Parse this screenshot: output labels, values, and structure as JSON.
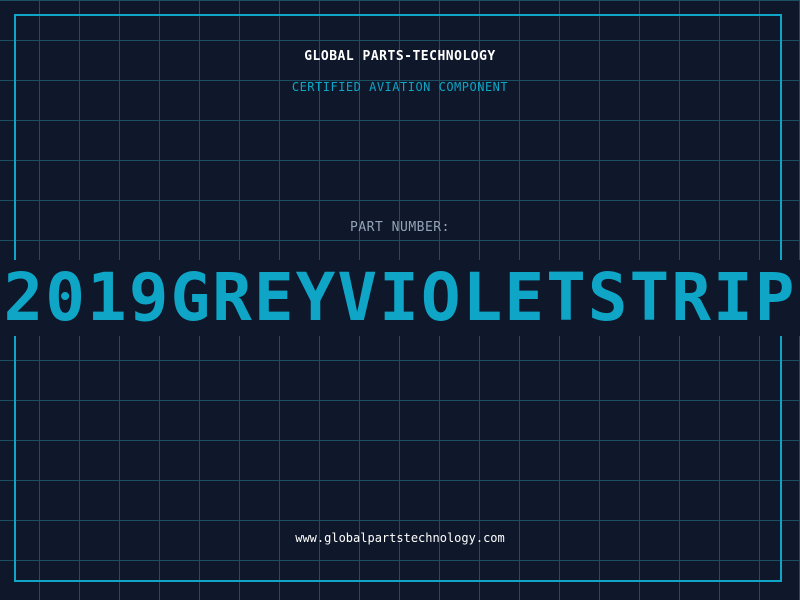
{
  "label": {
    "company": "GLOBAL PARTS-TECHNOLOGY",
    "certification": "CERTIFIED AVIATION COMPONENT",
    "part_number_label": "PART NUMBER:",
    "part_number": "2019GREYVIOLETSTRIP",
    "website": "www.globalpartstechnology.com"
  },
  "colors": {
    "background": "#0f172a",
    "grid": "#1d4f63",
    "accent": "#0ea5c6",
    "muted": "#94a3b8",
    "text": "#ffffff"
  }
}
